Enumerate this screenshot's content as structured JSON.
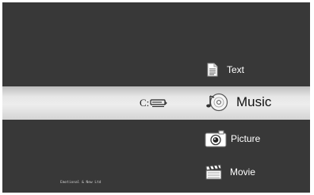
{
  "menu": {
    "items": [
      {
        "label": "Text",
        "icon": "document-icon",
        "active": false
      },
      {
        "label": "Music",
        "icon": "music-disc-icon",
        "active": true
      },
      {
        "label": "Picture",
        "icon": "camera-icon",
        "active": false
      },
      {
        "label": "Movie",
        "icon": "clapperboard-icon",
        "active": false
      }
    ]
  },
  "drive": {
    "label": "C:",
    "icon": "hard-drive-icon"
  },
  "footer": {
    "text": "Emotional & New Ltd"
  },
  "colors": {
    "background": "#383838",
    "highlight": "#e6e6e6",
    "label": "#ffffff",
    "active_label": "#111111"
  }
}
